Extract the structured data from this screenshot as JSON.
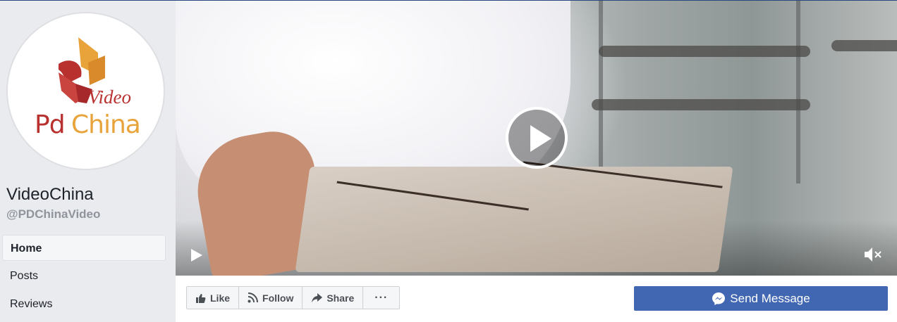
{
  "page": {
    "name": "VideoChina",
    "handle": "@PDChinaVideo",
    "logo": {
      "word1": "Video",
      "word2a": "Pd",
      "word2b": "China"
    }
  },
  "nav": {
    "items": [
      {
        "label": "Home",
        "active": true
      },
      {
        "label": "Posts",
        "active": false
      },
      {
        "label": "Reviews",
        "active": false
      }
    ]
  },
  "cover": {
    "play_icon": "play-icon",
    "mute_icon": "muted-speaker-icon"
  },
  "actions": {
    "like": "Like",
    "follow": "Follow",
    "share": "Share",
    "more": "···",
    "send_message": "Send Message"
  },
  "colors": {
    "primary": "#4267b2",
    "logo_red": "#b8312f",
    "logo_gold": "#e8a33a"
  }
}
